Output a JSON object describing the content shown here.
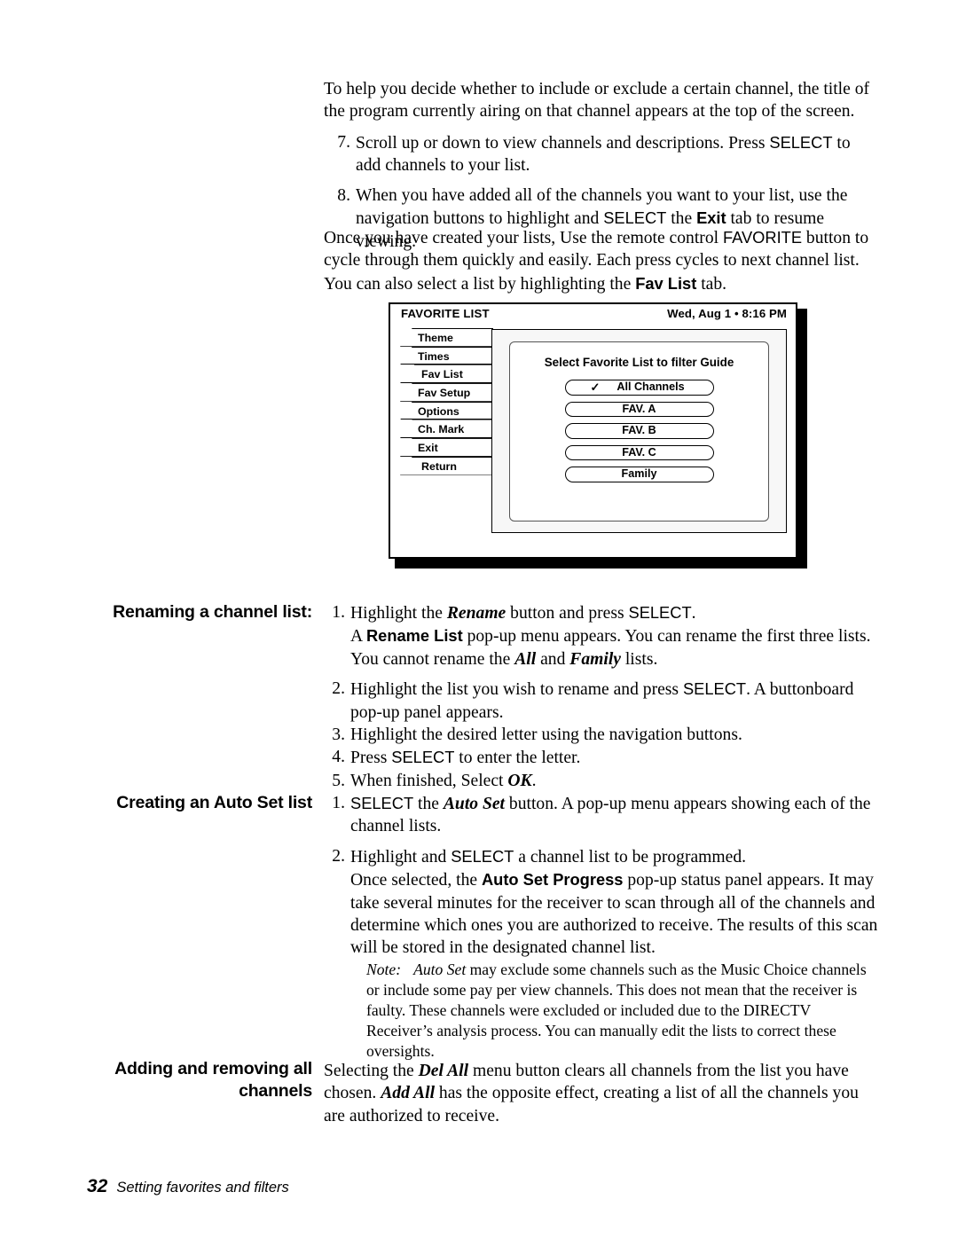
{
  "document": {
    "intro_paragraph": "To help you decide whether to include or exclude a certain channel, the title of the program currently airing on that channel appears at the top of the screen.",
    "steps_top": [
      {
        "num": "7.",
        "text_pre": "Scroll up or down to view channels and descriptions. Press ",
        "emph": "SELECT",
        "text_post": " to add channels to your list."
      },
      {
        "num": "8.",
        "text_pre": "When you have added all of the channels you want to your list, use the navigation buttons to highlight and ",
        "emph": "SELECT",
        "text_post": " the ",
        "bold": "Exit",
        "text_tail": " tab to resume viewing."
      }
    ],
    "favorite_paragraph_pre": "Once you have created your lists, Use the remote control ",
    "favorite_paragraph_key": "FAVORITE",
    "favorite_paragraph_mid": " button to cycle through them quickly and easily. Each press cycles to next channel list. You can also select a list by highlighting the ",
    "favorite_paragraph_tab": "Fav List",
    "favorite_paragraph_post": " tab."
  },
  "tv_screen": {
    "header_title": "FAVORITE LIST",
    "header_clock": "Wed, Aug 1 • 8:16 PM",
    "tabs": [
      {
        "label": "Theme",
        "state": "normal"
      },
      {
        "label": "Times",
        "state": "normal"
      },
      {
        "label": "Fav List",
        "state": "active"
      },
      {
        "label": "Fav Setup",
        "state": "normal"
      },
      {
        "label": "Options",
        "state": "normal"
      },
      {
        "label": "Ch. Mark",
        "state": "normal"
      },
      {
        "label": "Exit",
        "state": "normal"
      },
      {
        "label": "Return",
        "state": "normal"
      }
    ],
    "pane_title": "Select Favorite List to filter Guide",
    "check_glyph": "✓",
    "list_options": [
      {
        "label": "All Channels",
        "checked": true
      },
      {
        "label": "FAV. A",
        "checked": false
      },
      {
        "label": "FAV. B",
        "checked": false
      },
      {
        "label": "FAV. C",
        "checked": false
      },
      {
        "label": "Family",
        "checked": false
      }
    ]
  },
  "sections": {
    "renaming": {
      "heading": "Renaming a channel list:",
      "steps": [
        {
          "num": "1.",
          "a": "Highlight the ",
          "bi": "Rename",
          "b": " button and press ",
          "sans": "SELECT",
          "c": ".",
          "sublines": [
            {
              "a": "A ",
              "bold": "Rename List",
              "b": " pop-up menu appears. You can rename the first three lists. You cannot rename the ",
              "bi": "All",
              "c": " and ",
              "bi2": "Family",
              "d": " lists."
            }
          ]
        },
        {
          "num": "2.",
          "a": "Highlight the list you wish to rename and press ",
          "sans": "SELECT",
          "b": ". A buttonboard pop-up panel appears."
        },
        {
          "num": "3.",
          "a": "Highlight the desired letter using the navigation buttons."
        },
        {
          "num": "4.",
          "a": "Press ",
          "sans": "SELECT",
          "b": " to enter the letter."
        },
        {
          "num": "5.",
          "a": "When finished, Select ",
          "bi": "OK",
          "b": "."
        }
      ]
    },
    "autoset": {
      "heading": "Creating an Auto Set list",
      "steps": [
        {
          "num": "1.",
          "sans": "SELECT",
          "a": " the ",
          "bi": "Auto Set",
          "b": " button. A pop-up menu appears showing each of the channel lists."
        },
        {
          "num": "2.",
          "a": "Highlight and ",
          "sans": "SELECT",
          "b": " a channel list to be programmed.",
          "sublines": [
            {
              "a": "Once selected, the ",
              "bold": "Auto Set Progress",
              "b": " pop-up status panel appears. It may take several minutes for the receiver to scan through all of the channels and determine which ones you are authorized to receive. The results of this scan will be stored in the designated channel list."
            }
          ]
        }
      ],
      "note": {
        "label": "Note:",
        "emph": "Auto Set",
        "text": " may exclude some channels such as the Music Choice channels or include some pay per view channels. This does not mean that the receiver is faulty. These channels were excluded or included due to the DIRECTV Receiver’s analysis process. You can manually edit the lists to correct these oversights."
      }
    },
    "adding": {
      "heading_line1": "Adding and removing all",
      "heading_line2": "channels",
      "body_a": "Selecting the ",
      "body_bi": "Del All",
      "body_b": " menu button clears all channels from the list you have chosen. ",
      "body_bi2": "Add All",
      "body_c": " has the opposite effect, creating a list of all the channels you are authorized to receive."
    }
  },
  "footer": {
    "page_number": "32",
    "running_title": "Setting favorites and filters"
  }
}
